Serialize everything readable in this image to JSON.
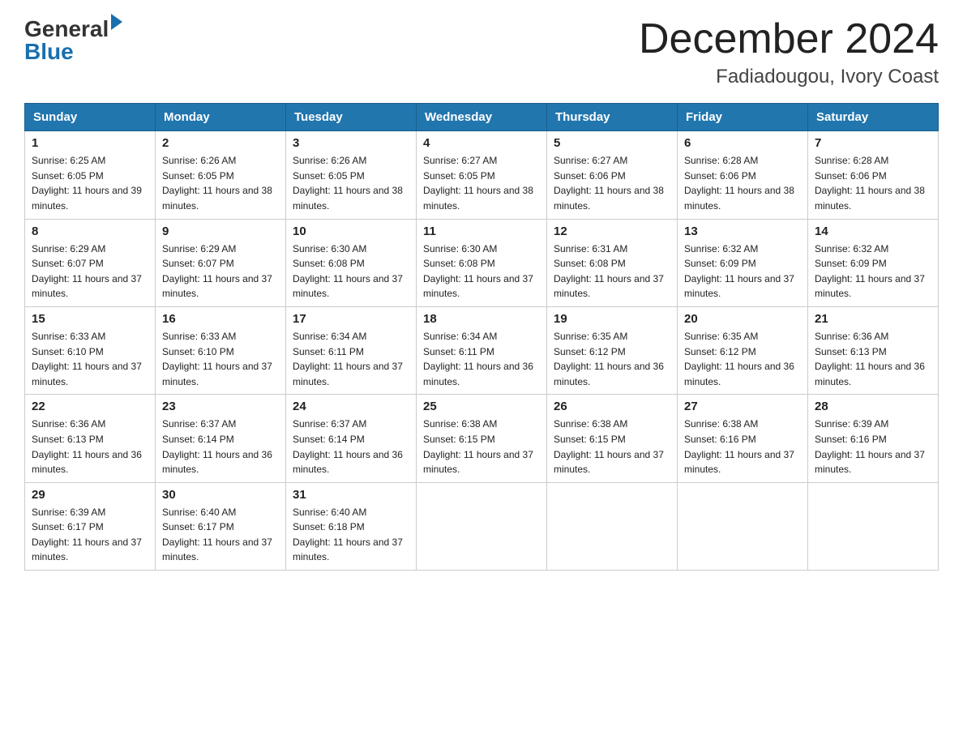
{
  "logo": {
    "line1": "General",
    "line2": "Blue"
  },
  "title": "December 2024",
  "subtitle": "Fadiadougou, Ivory Coast",
  "days_of_week": [
    "Sunday",
    "Monday",
    "Tuesday",
    "Wednesday",
    "Thursday",
    "Friday",
    "Saturday"
  ],
  "weeks": [
    [
      {
        "day": "1",
        "sunrise": "6:25 AM",
        "sunset": "6:05 PM",
        "daylight": "11 hours and 39 minutes."
      },
      {
        "day": "2",
        "sunrise": "6:26 AM",
        "sunset": "6:05 PM",
        "daylight": "11 hours and 38 minutes."
      },
      {
        "day": "3",
        "sunrise": "6:26 AM",
        "sunset": "6:05 PM",
        "daylight": "11 hours and 38 minutes."
      },
      {
        "day": "4",
        "sunrise": "6:27 AM",
        "sunset": "6:05 PM",
        "daylight": "11 hours and 38 minutes."
      },
      {
        "day": "5",
        "sunrise": "6:27 AM",
        "sunset": "6:06 PM",
        "daylight": "11 hours and 38 minutes."
      },
      {
        "day": "6",
        "sunrise": "6:28 AM",
        "sunset": "6:06 PM",
        "daylight": "11 hours and 38 minutes."
      },
      {
        "day": "7",
        "sunrise": "6:28 AM",
        "sunset": "6:06 PM",
        "daylight": "11 hours and 38 minutes."
      }
    ],
    [
      {
        "day": "8",
        "sunrise": "6:29 AM",
        "sunset": "6:07 PM",
        "daylight": "11 hours and 37 minutes."
      },
      {
        "day": "9",
        "sunrise": "6:29 AM",
        "sunset": "6:07 PM",
        "daylight": "11 hours and 37 minutes."
      },
      {
        "day": "10",
        "sunrise": "6:30 AM",
        "sunset": "6:08 PM",
        "daylight": "11 hours and 37 minutes."
      },
      {
        "day": "11",
        "sunrise": "6:30 AM",
        "sunset": "6:08 PM",
        "daylight": "11 hours and 37 minutes."
      },
      {
        "day": "12",
        "sunrise": "6:31 AM",
        "sunset": "6:08 PM",
        "daylight": "11 hours and 37 minutes."
      },
      {
        "day": "13",
        "sunrise": "6:32 AM",
        "sunset": "6:09 PM",
        "daylight": "11 hours and 37 minutes."
      },
      {
        "day": "14",
        "sunrise": "6:32 AM",
        "sunset": "6:09 PM",
        "daylight": "11 hours and 37 minutes."
      }
    ],
    [
      {
        "day": "15",
        "sunrise": "6:33 AM",
        "sunset": "6:10 PM",
        "daylight": "11 hours and 37 minutes."
      },
      {
        "day": "16",
        "sunrise": "6:33 AM",
        "sunset": "6:10 PM",
        "daylight": "11 hours and 37 minutes."
      },
      {
        "day": "17",
        "sunrise": "6:34 AM",
        "sunset": "6:11 PM",
        "daylight": "11 hours and 37 minutes."
      },
      {
        "day": "18",
        "sunrise": "6:34 AM",
        "sunset": "6:11 PM",
        "daylight": "11 hours and 36 minutes."
      },
      {
        "day": "19",
        "sunrise": "6:35 AM",
        "sunset": "6:12 PM",
        "daylight": "11 hours and 36 minutes."
      },
      {
        "day": "20",
        "sunrise": "6:35 AM",
        "sunset": "6:12 PM",
        "daylight": "11 hours and 36 minutes."
      },
      {
        "day": "21",
        "sunrise": "6:36 AM",
        "sunset": "6:13 PM",
        "daylight": "11 hours and 36 minutes."
      }
    ],
    [
      {
        "day": "22",
        "sunrise": "6:36 AM",
        "sunset": "6:13 PM",
        "daylight": "11 hours and 36 minutes."
      },
      {
        "day": "23",
        "sunrise": "6:37 AM",
        "sunset": "6:14 PM",
        "daylight": "11 hours and 36 minutes."
      },
      {
        "day": "24",
        "sunrise": "6:37 AM",
        "sunset": "6:14 PM",
        "daylight": "11 hours and 36 minutes."
      },
      {
        "day": "25",
        "sunrise": "6:38 AM",
        "sunset": "6:15 PM",
        "daylight": "11 hours and 37 minutes."
      },
      {
        "day": "26",
        "sunrise": "6:38 AM",
        "sunset": "6:15 PM",
        "daylight": "11 hours and 37 minutes."
      },
      {
        "day": "27",
        "sunrise": "6:38 AM",
        "sunset": "6:16 PM",
        "daylight": "11 hours and 37 minutes."
      },
      {
        "day": "28",
        "sunrise": "6:39 AM",
        "sunset": "6:16 PM",
        "daylight": "11 hours and 37 minutes."
      }
    ],
    [
      {
        "day": "29",
        "sunrise": "6:39 AM",
        "sunset": "6:17 PM",
        "daylight": "11 hours and 37 minutes."
      },
      {
        "day": "30",
        "sunrise": "6:40 AM",
        "sunset": "6:17 PM",
        "daylight": "11 hours and 37 minutes."
      },
      {
        "day": "31",
        "sunrise": "6:40 AM",
        "sunset": "6:18 PM",
        "daylight": "11 hours and 37 minutes."
      },
      null,
      null,
      null,
      null
    ]
  ]
}
